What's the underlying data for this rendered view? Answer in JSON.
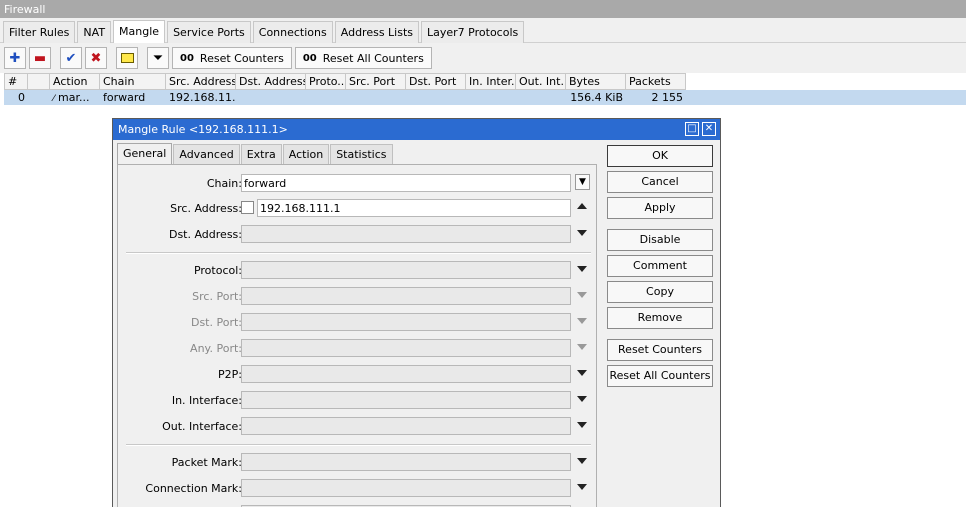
{
  "window": {
    "title": "Firewall"
  },
  "tabs": [
    "Filter Rules",
    "NAT",
    "Mangle",
    "Service Ports",
    "Connections",
    "Address Lists",
    "Layer7 Protocols"
  ],
  "active_tab": "Mangle",
  "toolbar": {
    "add_icon": "plus-icon",
    "remove_icon": "minus-icon",
    "enable_icon": "check-icon",
    "disable_icon": "x-icon",
    "comment_icon": "note-icon",
    "filter_icon": "filter-icon",
    "counter_glyph": "00",
    "reset_counters": "Reset Counters",
    "reset_all_counters": "Reset All Counters"
  },
  "table": {
    "columns": [
      "#",
      "",
      "Action",
      "Chain",
      "Src. Address",
      "Dst. Address",
      "Proto...",
      "Src. Port",
      "Dst. Port",
      "In. Inter...",
      "Out. Int...",
      "Bytes",
      "Packets"
    ],
    "rows": [
      {
        "num": "0",
        "flag": "",
        "action": "mar...",
        "chain": "forward",
        "src": "192.168.11...",
        "dst": "",
        "proto": "",
        "sport": "",
        "dport": "",
        "in": "",
        "out": "",
        "bytes": "156.4 KiB",
        "packets": "2 155"
      }
    ]
  },
  "dialog": {
    "title": "Mangle Rule <192.168.111.1>",
    "tabs": [
      "General",
      "Advanced",
      "Extra",
      "Action",
      "Statistics"
    ],
    "active_tab": "General",
    "fields": {
      "chain": {
        "label": "Chain:",
        "value": "forward"
      },
      "src_address": {
        "label": "Src. Address:",
        "value": "192.168.111.1"
      },
      "dst_address": {
        "label": "Dst. Address:",
        "value": ""
      },
      "protocol": {
        "label": "Protocol:",
        "value": ""
      },
      "src_port": {
        "label": "Src. Port:",
        "value": ""
      },
      "dst_port": {
        "label": "Dst. Port:",
        "value": ""
      },
      "any_port": {
        "label": "Any. Port:",
        "value": ""
      },
      "p2p": {
        "label": "P2P:",
        "value": ""
      },
      "in_interface": {
        "label": "In. Interface:",
        "value": ""
      },
      "out_interface": {
        "label": "Out. Interface:",
        "value": ""
      },
      "packet_mark": {
        "label": "Packet Mark:",
        "value": ""
      },
      "connection_mark": {
        "label": "Connection Mark:",
        "value": ""
      }
    },
    "buttons": {
      "ok": "OK",
      "cancel": "Cancel",
      "apply": "Apply",
      "disable": "Disable",
      "comment": "Comment",
      "copy": "Copy",
      "remove": "Remove",
      "reset_counters": "Reset Counters",
      "reset_all_counters": "Reset All Counters"
    }
  },
  "colors": {
    "selected_row": "#c3d9ef",
    "dialog_title": "#2b6bd1",
    "window_title": "#a9a9a9"
  }
}
